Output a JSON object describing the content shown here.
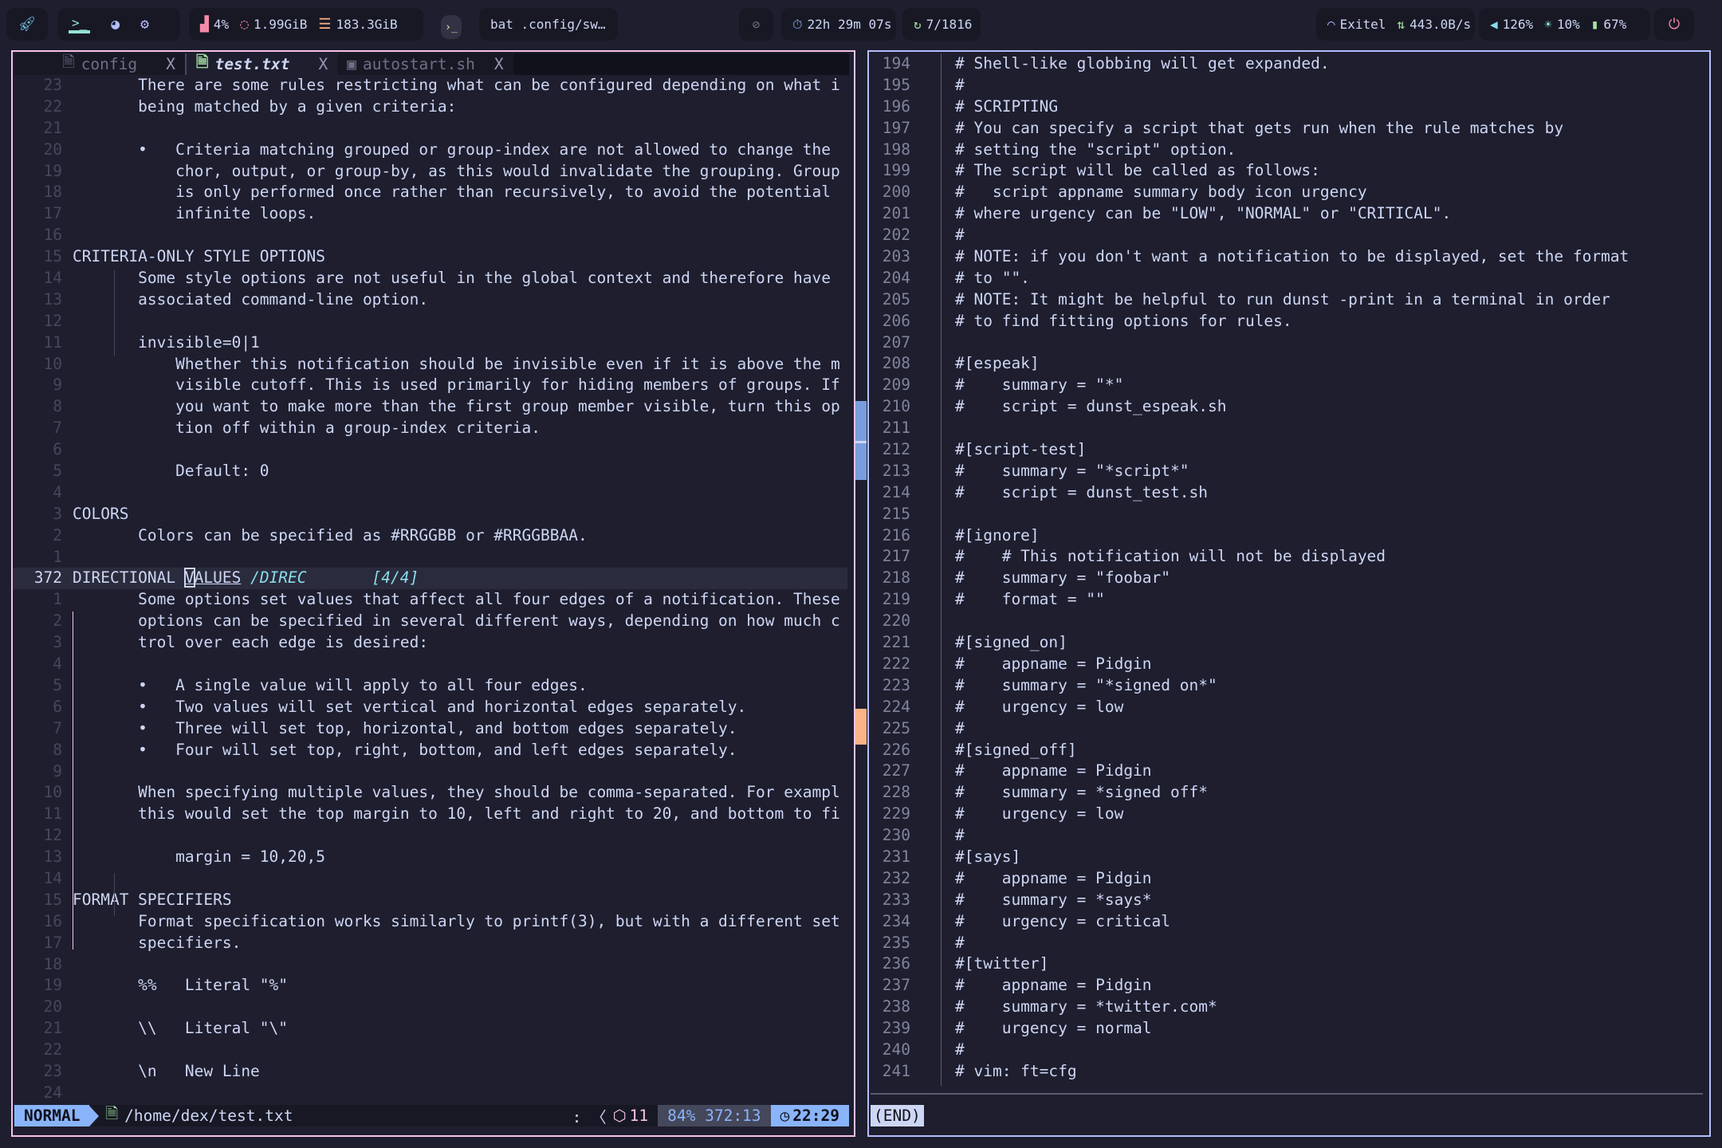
{
  "topbar": {
    "launcher_icon": "rocket-icon",
    "workspaces": [
      {
        "icon": "terminal-icon",
        "active": true
      },
      {
        "icon": "firefox-icon"
      },
      {
        "icon": "gear-icon"
      }
    ],
    "cpu": "4%",
    "memory": "1.99GiB",
    "disk": "183.3GiB",
    "window_title": "bat .config/sw…",
    "idle_icon": "eye-off-icon",
    "uptime": "22h 29m 07s",
    "updates": "7/1816",
    "network": "Exitel",
    "net_speed": "443.0B/s",
    "volume": "126%",
    "brightness": "10%",
    "battery": "67%",
    "power_icon": "power-icon"
  },
  "left": {
    "tabs": [
      {
        "label": "config",
        "close": "X",
        "active": false
      },
      {
        "label": "test.txt",
        "close": "X",
        "active": true
      },
      {
        "label": "autostart.sh",
        "close": "X",
        "active": false
      }
    ],
    "lines": [
      [
        "23",
        "       There are some rules restricting what can be configured depending on what i"
      ],
      [
        "22",
        "       being matched by a given criteria:"
      ],
      [
        "21",
        ""
      ],
      [
        "20",
        "       •   Criteria matching grouped or group-index are not allowed to change the"
      ],
      [
        "19",
        "           chor, output, or group-by, as this would invalidate the grouping. Group"
      ],
      [
        "18",
        "           is only performed once rather than recursively, to avoid the potential"
      ],
      [
        "17",
        "           infinite loops."
      ],
      [
        "16",
        ""
      ],
      [
        "15",
        "CRITERIA-ONLY STYLE OPTIONS"
      ],
      [
        "14",
        "       Some style options are not useful in the global context and therefore have"
      ],
      [
        "13",
        "       associated command-line option."
      ],
      [
        "12",
        ""
      ],
      [
        "11",
        "       invisible=0|1"
      ],
      [
        "10",
        "           Whether this notification should be invisible even if it is above the m"
      ],
      [
        "9",
        "           visible cutoff. This is used primarily for hiding members of groups. If"
      ],
      [
        "8",
        "           you want to make more than the first group member visible, turn this op"
      ],
      [
        "7",
        "           tion off within a group-index criteria."
      ],
      [
        "6",
        ""
      ],
      [
        "5",
        "           Default: 0"
      ],
      [
        "4",
        ""
      ],
      [
        "3",
        "COLORS"
      ],
      [
        "2",
        "       Colors can be specified as #RRGGBB or #RRGGBBAA."
      ],
      [
        "1",
        ""
      ]
    ],
    "current": {
      "num": "372",
      "pre": "DIRECTIONAL ",
      "cursor_char": "V",
      "post": "ALUES",
      "search": " /DIREC",
      "count": "[4/4]"
    },
    "lines_after": [
      [
        "1",
        "       Some options set values that affect all four edges of a notification. These"
      ],
      [
        "2",
        "       options can be specified in several different ways, depending on how much c"
      ],
      [
        "3",
        "       trol over each edge is desired:"
      ],
      [
        "4",
        ""
      ],
      [
        "5",
        "       •   A single value will apply to all four edges."
      ],
      [
        "6",
        "       •   Two values will set vertical and horizontal edges separately."
      ],
      [
        "7",
        "       •   Three will set top, horizontal, and bottom edges separately."
      ],
      [
        "8",
        "       •   Four will set top, right, bottom, and left edges separately."
      ],
      [
        "9",
        ""
      ],
      [
        "10",
        "       When specifying multiple values, they should be comma-separated. For exampl"
      ],
      [
        "11",
        "       this would set the top margin to 10, left and right to 20, and bottom to fi"
      ],
      [
        "12",
        ""
      ],
      [
        "13",
        "           margin = 10,20,5"
      ],
      [
        "14",
        ""
      ],
      [
        "15",
        "FORMAT SPECIFIERS"
      ],
      [
        "16",
        "       Format specification works similarly to printf(3), but with a different set"
      ],
      [
        "17",
        "       specifiers."
      ],
      [
        "18",
        ""
      ],
      [
        "19",
        "       %%   Literal \"%\""
      ],
      [
        "20",
        ""
      ],
      [
        "21",
        "       \\\\   Literal \"\\\""
      ],
      [
        "22",
        ""
      ],
      [
        "23",
        "       \\n   New Line"
      ],
      [
        "24",
        ""
      ]
    ],
    "status": {
      "mode": "NORMAL",
      "path": "/home/dex/test.txt",
      "lsp": ": 〈",
      "package_count": "11",
      "position": "84% 372:13",
      "clock": "22:29"
    }
  },
  "right": {
    "lines": [
      [
        "194",
        "# Shell-like globbing will get expanded."
      ],
      [
        "195",
        "#"
      ],
      [
        "196",
        "# SCRIPTING"
      ],
      [
        "197",
        "# You can specify a script that gets run when the rule matches by"
      ],
      [
        "198",
        "# setting the \"script\" option."
      ],
      [
        "199",
        "# The script will be called as follows:"
      ],
      [
        "200",
        "#   script appname summary body icon urgency"
      ],
      [
        "201",
        "# where urgency can be \"LOW\", \"NORMAL\" or \"CRITICAL\"."
      ],
      [
        "202",
        "#"
      ],
      [
        "203",
        "# NOTE: if you don't want a notification to be displayed, set the format"
      ],
      [
        "204",
        "# to \"\"."
      ],
      [
        "205",
        "# NOTE: It might be helpful to run dunst -print in a terminal in order"
      ],
      [
        "206",
        "# to find fitting options for rules."
      ],
      [
        "207",
        ""
      ],
      [
        "208",
        "#[espeak]"
      ],
      [
        "209",
        "#    summary = \"*\""
      ],
      [
        "210",
        "#    script = dunst_espeak.sh"
      ],
      [
        "211",
        ""
      ],
      [
        "212",
        "#[script-test]"
      ],
      [
        "213",
        "#    summary = \"*script*\""
      ],
      [
        "214",
        "#    script = dunst_test.sh"
      ],
      [
        "215",
        ""
      ],
      [
        "216",
        "#[ignore]"
      ],
      [
        "217",
        "#    # This notification will not be displayed"
      ],
      [
        "218",
        "#    summary = \"foobar\""
      ],
      [
        "219",
        "#    format = \"\""
      ],
      [
        "220",
        ""
      ],
      [
        "221",
        "#[signed_on]"
      ],
      [
        "222",
        "#    appname = Pidgin"
      ],
      [
        "223",
        "#    summary = \"*signed on*\""
      ],
      [
        "224",
        "#    urgency = low"
      ],
      [
        "225",
        "#"
      ],
      [
        "226",
        "#[signed_off]"
      ],
      [
        "227",
        "#    appname = Pidgin"
      ],
      [
        "228",
        "#    summary = *signed off*"
      ],
      [
        "229",
        "#    urgency = low"
      ],
      [
        "230",
        "#"
      ],
      [
        "231",
        "#[says]"
      ],
      [
        "232",
        "#    appname = Pidgin"
      ],
      [
        "233",
        "#    summary = *says*"
      ],
      [
        "234",
        "#    urgency = critical"
      ],
      [
        "235",
        "#"
      ],
      [
        "236",
        "#[twitter]"
      ],
      [
        "237",
        "#    appname = Pidgin"
      ],
      [
        "238",
        "#    summary = *twitter.com*"
      ],
      [
        "239",
        "#    urgency = normal"
      ],
      [
        "240",
        "#"
      ],
      [
        "241",
        "# vim: ft=cfg"
      ]
    ],
    "pager_status": "(END)"
  },
  "colors": {
    "bg": "#1e1e2e",
    "text": "#cdd6f4",
    "left_border": "#f5c2e7",
    "right_border": "#b4befe",
    "accent": "#89b4fa",
    "search": "#89dceb"
  }
}
